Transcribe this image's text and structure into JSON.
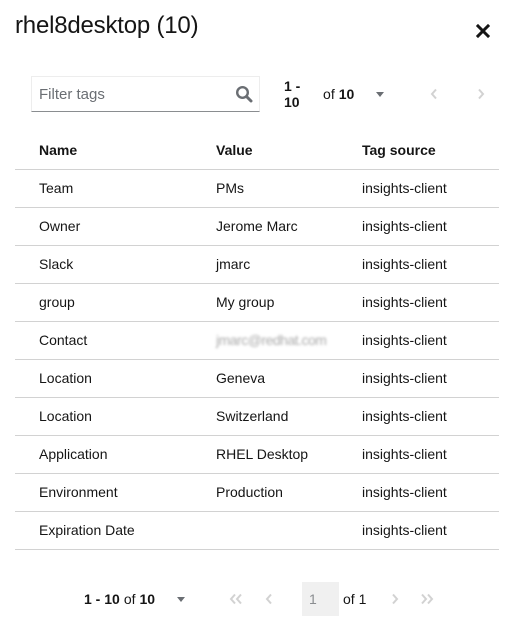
{
  "modal": {
    "title": "rhel8desktop (10)",
    "close_icon": "close-icon"
  },
  "toolbar": {
    "filter_placeholder": "Filter tags",
    "filter_value": "",
    "search_icon": "search-icon",
    "pagination": {
      "range": "1 - 10",
      "of_label": "of",
      "total": "10",
      "prev_icon": "angle-left-icon",
      "next_icon": "angle-right-icon"
    }
  },
  "table": {
    "columns": [
      "Name",
      "Value",
      "Tag source"
    ],
    "rows": [
      {
        "name": "Team",
        "value": "PMs",
        "source": "insights-client"
      },
      {
        "name": "Owner",
        "value": "Jerome Marc",
        "source": "insights-client"
      },
      {
        "name": "Slack",
        "value": "jmarc",
        "source": "insights-client"
      },
      {
        "name": "group",
        "value": "My group",
        "source": "insights-client"
      },
      {
        "name": "Contact",
        "value": "jmarc@redhat.com",
        "value_redacted": true,
        "source": "insights-client"
      },
      {
        "name": "Location",
        "value": "Geneva",
        "source": "insights-client"
      },
      {
        "name": "Location",
        "value": "Switzerland",
        "source": "insights-client"
      },
      {
        "name": "Application",
        "value": "RHEL Desktop",
        "source": "insights-client"
      },
      {
        "name": "Environment",
        "value": "Production",
        "source": "insights-client"
      },
      {
        "name": "Expiration Date",
        "value": "",
        "source": "insights-client"
      }
    ]
  },
  "footer_pagination": {
    "range": "1 - 10",
    "of_label": "of",
    "total": "10",
    "current_page": "1",
    "of_pages": "of 1",
    "first_icon": "angle-double-left-icon",
    "prev_icon": "angle-left-icon",
    "next_icon": "angle-right-icon",
    "last_icon": "angle-double-right-icon"
  }
}
